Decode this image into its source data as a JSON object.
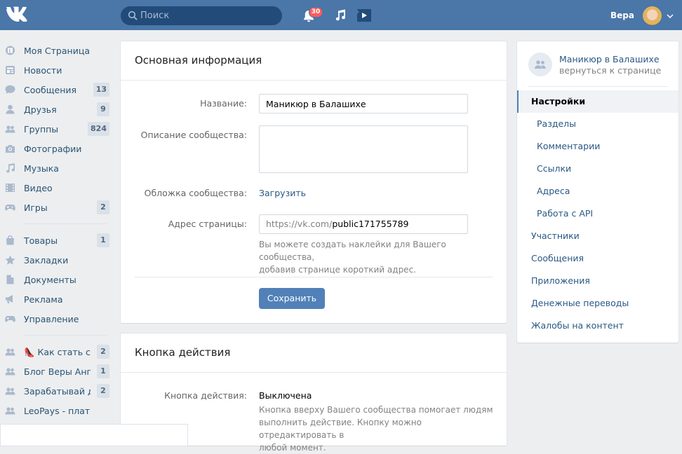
{
  "header": {
    "search_placeholder": "Поиск",
    "notifications_count": "30",
    "user_name": "Вера"
  },
  "sidebar": {
    "items": [
      {
        "label": "Моя Страница",
        "count": "",
        "icon": "user-circle-icon"
      },
      {
        "label": "Новости",
        "count": "",
        "icon": "news-icon"
      },
      {
        "label": "Сообщения",
        "count": "13",
        "icon": "chat-icon"
      },
      {
        "label": "Друзья",
        "count": "9",
        "icon": "person-icon"
      },
      {
        "label": "Группы",
        "count": "824",
        "icon": "people-icon"
      },
      {
        "label": "Фотографии",
        "count": "",
        "icon": "camera-icon"
      },
      {
        "label": "Музыка",
        "count": "",
        "icon": "music-icon"
      },
      {
        "label": "Видео",
        "count": "",
        "icon": "film-icon"
      },
      {
        "label": "Игры",
        "count": "2",
        "icon": "gamepad-icon"
      }
    ],
    "items2": [
      {
        "label": "Товары",
        "count": "1",
        "icon": "bag-icon"
      },
      {
        "label": "Закладки",
        "count": "",
        "icon": "star-icon"
      },
      {
        "label": "Документы",
        "count": "",
        "icon": "document-icon"
      },
      {
        "label": "Реклама",
        "count": "",
        "icon": "megaphone-icon"
      },
      {
        "label": "Управление",
        "count": "",
        "icon": "gamepad-icon"
      }
    ],
    "groups": [
      {
        "label": "👠 Как стать сч...",
        "count": "2"
      },
      {
        "label": "Блог Веры Анге...",
        "count": "1"
      },
      {
        "label": "Зарабатывай д...",
        "count": "2"
      },
      {
        "label": "LeoPays - платф...",
        "count": ""
      }
    ]
  },
  "main": {
    "basic_info": {
      "title": "Основная информация",
      "name_label": "Название:",
      "name_value": "Маникюр в Балашихе",
      "description_label": "Описание сообщества:",
      "description_value": "",
      "cover_label": "Обложка сообщества:",
      "cover_action": "Загрузить",
      "address_label": "Адрес страницы:",
      "address_prefix": "https://vk.com/",
      "address_value": "public171755789",
      "address_hint_1": "Вы можете создать наклейки для Вашего сообщества,",
      "address_hint_2": "добавив странице короткий адрес.",
      "save_label": "Сохранить"
    },
    "action_button": {
      "title": "Кнопка действия",
      "label": "Кнопка действия:",
      "value": "Выключена",
      "hint_1": "Кнопка вверху Вашего сообщества помогает людям",
      "hint_2": "выполнить действие. Кнопку можно отредактировать в",
      "hint_3": "любой момент."
    }
  },
  "right_panel": {
    "group_name": "Маникюр в Балашихе",
    "back_link": "вернуться к странице",
    "menu": [
      {
        "label": "Настройки",
        "active": true,
        "sub": false
      },
      {
        "label": "Разделы",
        "active": false,
        "sub": true
      },
      {
        "label": "Комментарии",
        "active": false,
        "sub": true
      },
      {
        "label": "Ссылки",
        "active": false,
        "sub": true
      },
      {
        "label": "Адреса",
        "active": false,
        "sub": true
      },
      {
        "label": "Работа с API",
        "active": false,
        "sub": true
      },
      {
        "label": "Участники",
        "active": false,
        "sub": false
      },
      {
        "label": "Сообщения",
        "active": false,
        "sub": false
      },
      {
        "label": "Приложения",
        "active": false,
        "sub": false
      },
      {
        "label": "Денежные переводы",
        "active": false,
        "sub": false
      },
      {
        "label": "Жалобы на контент",
        "active": false,
        "sub": false
      }
    ]
  },
  "colors": {
    "header_bg": "#4a76a8",
    "link": "#2a5885",
    "button": "#5181b8",
    "badge": "#ff5c5c"
  }
}
